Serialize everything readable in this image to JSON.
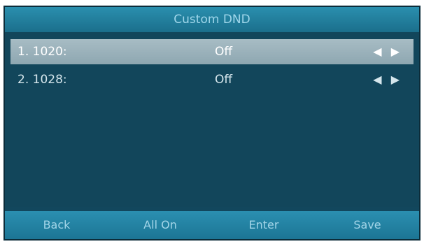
{
  "window": {
    "title": "Custom DND"
  },
  "list": {
    "items": [
      {
        "label": "1. 1020:",
        "value": "Off",
        "arrows": "◀ ▶",
        "selected": true
      },
      {
        "label": "2. 1028:",
        "value": "Off",
        "arrows": "◀ ▶",
        "selected": false
      }
    ]
  },
  "softkeys": {
    "back": "Back",
    "all_on": "All On",
    "enter": "Enter",
    "save": "Save"
  },
  "colors": {
    "background": "#12465b",
    "title_bar": "#1b6f8c",
    "selected_row": "#9bb2bb",
    "softkey_bar": "#1c7595"
  }
}
